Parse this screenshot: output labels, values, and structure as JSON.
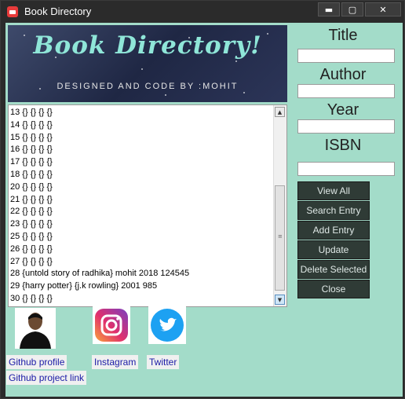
{
  "window": {
    "title": "Book Directory",
    "controls": {
      "minimize": "▬",
      "maximize": "▢",
      "close": "✕"
    }
  },
  "banner": {
    "title": "Book Directory!",
    "subtitle": "DESIGNED AND CODE BY :MOHIT"
  },
  "listbox": {
    "items": [
      "13 {} {} {} {}",
      "14 {} {} {} {}",
      "15 {} {} {} {}",
      "16 {} {} {} {}",
      "17 {} {} {} {}",
      "18 {} {} {} {}",
      "20 {} {} {} {}",
      "21 {} {} {} {}",
      "22 {} {} {} {}",
      "23 {} {} {} {}",
      "25 {} {} {} {}",
      "26 {} {} {} {}",
      "27 {} {} {} {}",
      "28 {untold story of radhika} mohit 2018 124545",
      "29 {harry potter} {j.k rowling} 2001 985",
      "30 {} {} {} {}"
    ]
  },
  "form": {
    "title_label": "Title",
    "author_label": "Author",
    "year_label": "Year",
    "isbn_label": "ISBN",
    "title_value": "",
    "author_value": "",
    "year_value": "",
    "isbn_value": ""
  },
  "buttons": {
    "view_all": "View All",
    "search_entry": "Search Entry",
    "add_entry": "Add Entry",
    "update": "Update",
    "delete_selected": "Delete Selected",
    "close": "Close"
  },
  "links": {
    "github_profile": "Github profile",
    "github_project": "Github project link",
    "instagram": "Instagram",
    "twitter": "Twitter"
  },
  "colors": {
    "background": "#a3dcc9",
    "button": "#2f3b36",
    "banner_text": "#8fe6d8",
    "link": "#1a1aa6"
  }
}
